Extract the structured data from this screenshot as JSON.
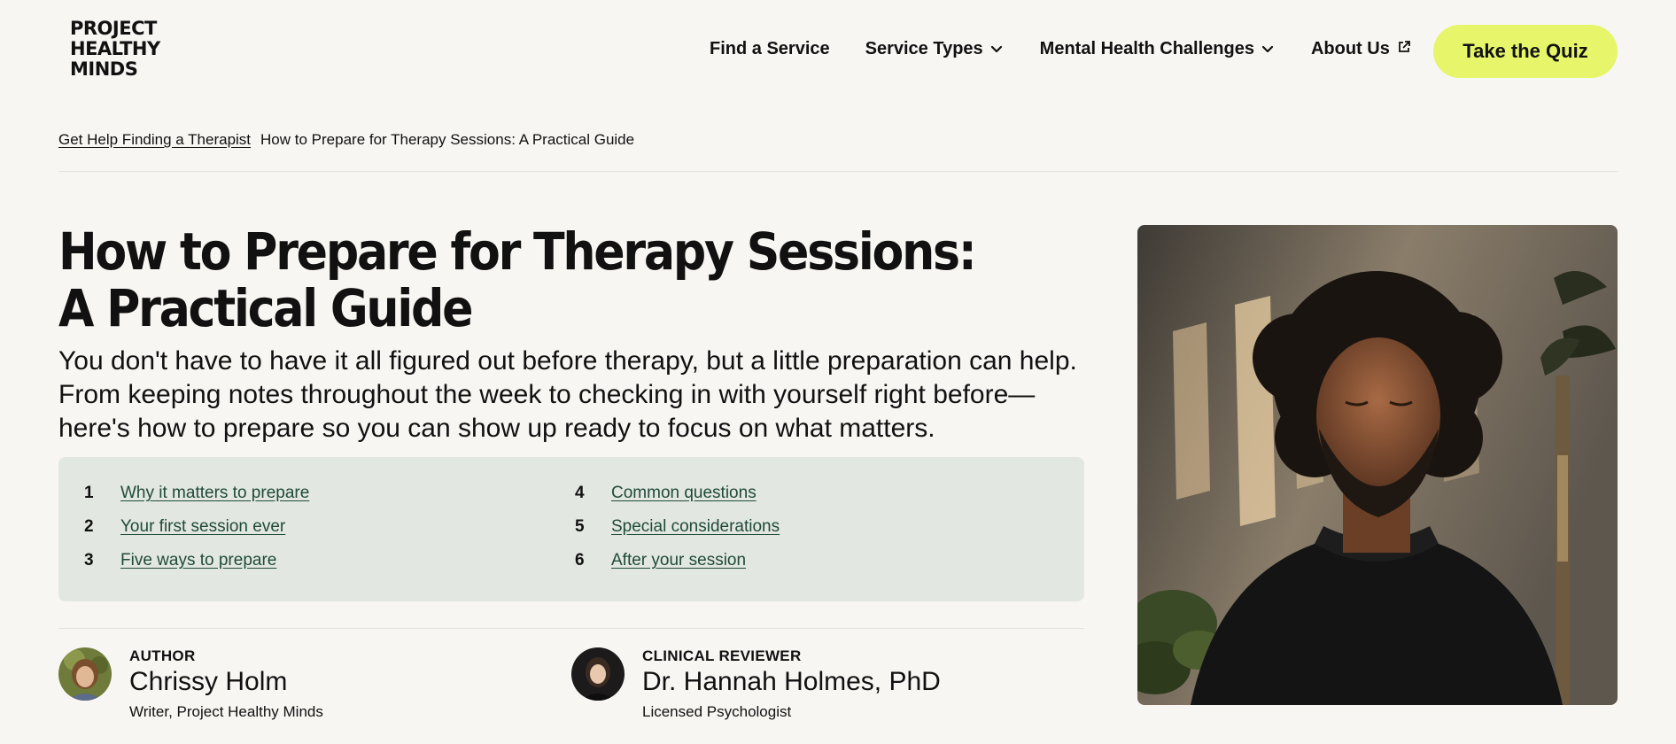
{
  "header": {
    "logo_lines": [
      "PROJECT",
      "HEALTHY",
      "MINDS"
    ],
    "nav": [
      {
        "label": "Find a Service",
        "icon": ""
      },
      {
        "label": "Service Types",
        "icon": "chevron-down-icon"
      },
      {
        "label": "Mental Health Challenges",
        "icon": "chevron-down-icon"
      },
      {
        "label": "About Us",
        "icon": "external-link-icon"
      }
    ],
    "cta_label": "Take the Quiz",
    "cta_color": "#e6f56a"
  },
  "breadcrumb": {
    "parent": "Get Help Finding a Therapist",
    "current": "How to Prepare for Therapy Sessions: A Practical Guide"
  },
  "article": {
    "title": "How to Prepare for Therapy Sessions: A Practical Guide",
    "intro": "You don't have to have it all figured out before therapy, but a little preparation can help. From keeping notes throughout the week to checking in with yourself right before—here's how to prepare so you can show up ready to focus on what matters."
  },
  "toc": {
    "background": "#e2e7e1",
    "link_color": "#1f4a3a",
    "items": [
      {
        "num": "1",
        "label": "Why it matters to prepare"
      },
      {
        "num": "2",
        "label": "Your first session ever"
      },
      {
        "num": "3",
        "label": "Five ways to prepare"
      },
      {
        "num": "4",
        "label": "Common questions"
      },
      {
        "num": "5",
        "label": "Special considerations"
      },
      {
        "num": "6",
        "label": "After your session"
      }
    ]
  },
  "bylines": {
    "author": {
      "role": "AUTHOR",
      "name": "Chrissy Holm",
      "title": "Writer, Project Healthy Minds"
    },
    "reviewer": {
      "role": "CLINICAL REVIEWER",
      "name": "Dr. Hannah Holmes, PhD",
      "title": "Licensed Psychologist"
    }
  },
  "colors": {
    "page_background": "#f8f6f3",
    "text": "#111111"
  }
}
